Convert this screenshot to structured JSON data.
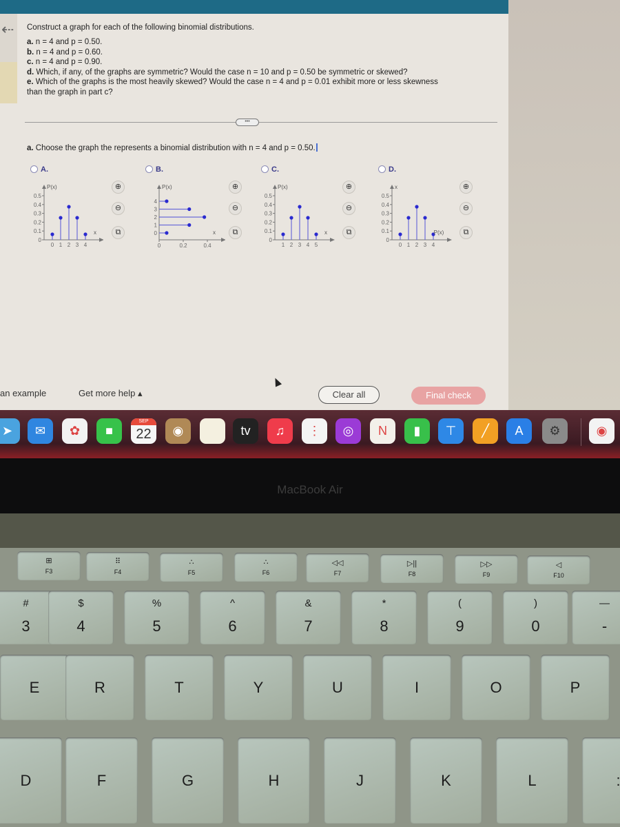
{
  "question": {
    "intro": "Construct a graph for each of the following binomial distributions.",
    "parts": [
      {
        "letter": "a.",
        "text": " n = 4 and p = 0.50."
      },
      {
        "letter": "b.",
        "text": " n = 4 and p = 0.60."
      },
      {
        "letter": "c.",
        "text": " n = 4 and p = 0.90."
      },
      {
        "letter": "d.",
        "text": " Which, if any, of the graphs are symmetric? Would the case n = 10 and p = 0.50 be symmetric or skewed?"
      },
      {
        "letter": "e.",
        "text": " Which of the graphs is the most heavily skewed? Would the case n = 4 and p = 0.01 exhibit more or less skewness"
      },
      {
        "letter": "",
        "text": "than the graph in part c?"
      }
    ],
    "more_label": "•••"
  },
  "subquestion": {
    "letter": "a.",
    "text": " Choose the graph the represents a binomial distribution with n = 4 and p = 0.50."
  },
  "options": [
    {
      "label": "A.",
      "selected": false
    },
    {
      "label": "B.",
      "selected": false
    },
    {
      "label": "C.",
      "selected": false
    },
    {
      "label": "D.",
      "selected": false
    }
  ],
  "tools": {
    "zoom_in": "⊕",
    "zoom_out": "⊖",
    "popout": "⧉"
  },
  "chart_data": [
    {
      "type": "scatter",
      "option": "A",
      "orientation": "vertical",
      "x": [
        0,
        1,
        2,
        3,
        4
      ],
      "values": [
        0.0625,
        0.25,
        0.375,
        0.25,
        0.0625
      ],
      "xlabel": "x",
      "ylabel": "P(x)",
      "xticks": [
        "0",
        "1",
        "2",
        "3",
        "4"
      ],
      "yticks": [
        "0",
        "0.1",
        "0.2",
        "0.3",
        "0.4",
        "0.5"
      ],
      "ylim": [
        0,
        0.5
      ],
      "grid": false
    },
    {
      "type": "scatter",
      "option": "B",
      "orientation": "horizontal",
      "x": [
        0,
        1,
        2,
        3,
        4
      ],
      "values": [
        0.0625,
        0.25,
        0.375,
        0.25,
        0.0625
      ],
      "xlabel": "x",
      "ylabel": "P(x)",
      "xticks": [
        "0",
        "0.2",
        "0.4"
      ],
      "yticks": [
        "0",
        "1",
        "2",
        "3",
        "4"
      ],
      "xlim": [
        0,
        0.5
      ],
      "grid": false
    },
    {
      "type": "scatter",
      "option": "C",
      "orientation": "vertical",
      "x": [
        1,
        2,
        3,
        4,
        5
      ],
      "values": [
        0.0625,
        0.25,
        0.375,
        0.25,
        0.0625
      ],
      "xlabel": "x",
      "ylabel": "P(x)",
      "xticks": [
        "1",
        "2",
        "3",
        "4",
        "5"
      ],
      "yticks": [
        "0",
        "0.1",
        "0.2",
        "0.3",
        "0.4",
        "0.5"
      ],
      "ylim": [
        0,
        0.5
      ],
      "grid": false
    },
    {
      "type": "scatter",
      "option": "D",
      "orientation": "vertical",
      "x": [
        0,
        1,
        2,
        3,
        4
      ],
      "values": [
        0.0625,
        0.25,
        0.375,
        0.25,
        0.0625
      ],
      "xlabel": "P(x)",
      "ylabel": "x",
      "xticks": [
        "0",
        "1",
        "2",
        "3",
        "4"
      ],
      "yticks": [
        "0",
        "0.1",
        "0.2",
        "0.3",
        "0.4",
        "0.5"
      ],
      "ylim": [
        0,
        0.5
      ],
      "grid": false
    }
  ],
  "footer": {
    "example_label": "an example",
    "help_label": "Get more help ▴",
    "clear_label": "Clear all",
    "final_label": "Final check"
  },
  "colors": {
    "accent": "#1e6a86",
    "point": "#2a2acf",
    "stem": "#6c6cd8",
    "final_btn": "#e8a3a3"
  },
  "dock": {
    "items": [
      {
        "name": "maps",
        "glyph": "➤",
        "color": "#4aa3df"
      },
      {
        "name": "mail",
        "glyph": "✉",
        "color": "#2f86e0"
      },
      {
        "name": "photos",
        "glyph": "✿",
        "color": "#f2f2f2"
      },
      {
        "name": "facetime",
        "glyph": "■",
        "color": "#37c24a"
      },
      {
        "name": "calendar",
        "glyph": "22",
        "month": "SEP",
        "color": "#f6f6f6"
      },
      {
        "name": "contacts",
        "glyph": "◉",
        "color": "#b08956"
      },
      {
        "name": "notes",
        "glyph": "",
        "color": "#f4f0e0"
      },
      {
        "name": "apple-tv",
        "glyph": "tv",
        "color": "#222"
      },
      {
        "name": "music",
        "glyph": "♫",
        "color": "#ef3c4b"
      },
      {
        "name": "reminders",
        "glyph": "⋮",
        "color": "#f4f4f4"
      },
      {
        "name": "podcasts",
        "glyph": "◎",
        "color": "#9b3bd6"
      },
      {
        "name": "news",
        "glyph": "N",
        "color": "#f3f0ea"
      },
      {
        "name": "numbers",
        "glyph": "▮",
        "color": "#38c04a"
      },
      {
        "name": "keynote",
        "glyph": "⊤",
        "color": "#2e88e6"
      },
      {
        "name": "pages",
        "glyph": "╱",
        "color": "#f2a024"
      },
      {
        "name": "app-store",
        "glyph": "A",
        "color": "#2a7fe6"
      },
      {
        "name": "system-preferences",
        "glyph": "⚙",
        "color": "#8a8a8a"
      },
      {
        "name": "chrome",
        "glyph": "◉",
        "color": "#f3f3f3"
      }
    ]
  },
  "device": {
    "brand": "MacBook Air"
  },
  "keyboard": {
    "fkeys": [
      {
        "sym": "⊞",
        "label": "F3"
      },
      {
        "sym": "⠿",
        "label": "F4"
      },
      {
        "sym": "∴",
        "label": "F5"
      },
      {
        "sym": "∴",
        "label": "F6"
      },
      {
        "sym": "◁◁",
        "label": "F7"
      },
      {
        "sym": "▷||",
        "label": "F8"
      },
      {
        "sym": "▷▷",
        "label": "F9"
      },
      {
        "sym": "◁",
        "label": "F10"
      }
    ],
    "numbers": [
      {
        "shift": "#",
        "main": "3"
      },
      {
        "shift": "$",
        "main": "4"
      },
      {
        "shift": "%",
        "main": "5"
      },
      {
        "shift": "^",
        "main": "6"
      },
      {
        "shift": "&",
        "main": "7"
      },
      {
        "shift": "*",
        "main": "8"
      },
      {
        "shift": "(",
        "main": "9"
      },
      {
        "shift": ")",
        "main": "0"
      },
      {
        "shift": "—",
        "main": "-"
      }
    ],
    "row_top": [
      "E",
      "R",
      "T",
      "Y",
      "U",
      "I",
      "O",
      "P"
    ],
    "row_home": [
      "D",
      "F",
      "G",
      "H",
      "J",
      "K",
      "L",
      ":"
    ]
  }
}
